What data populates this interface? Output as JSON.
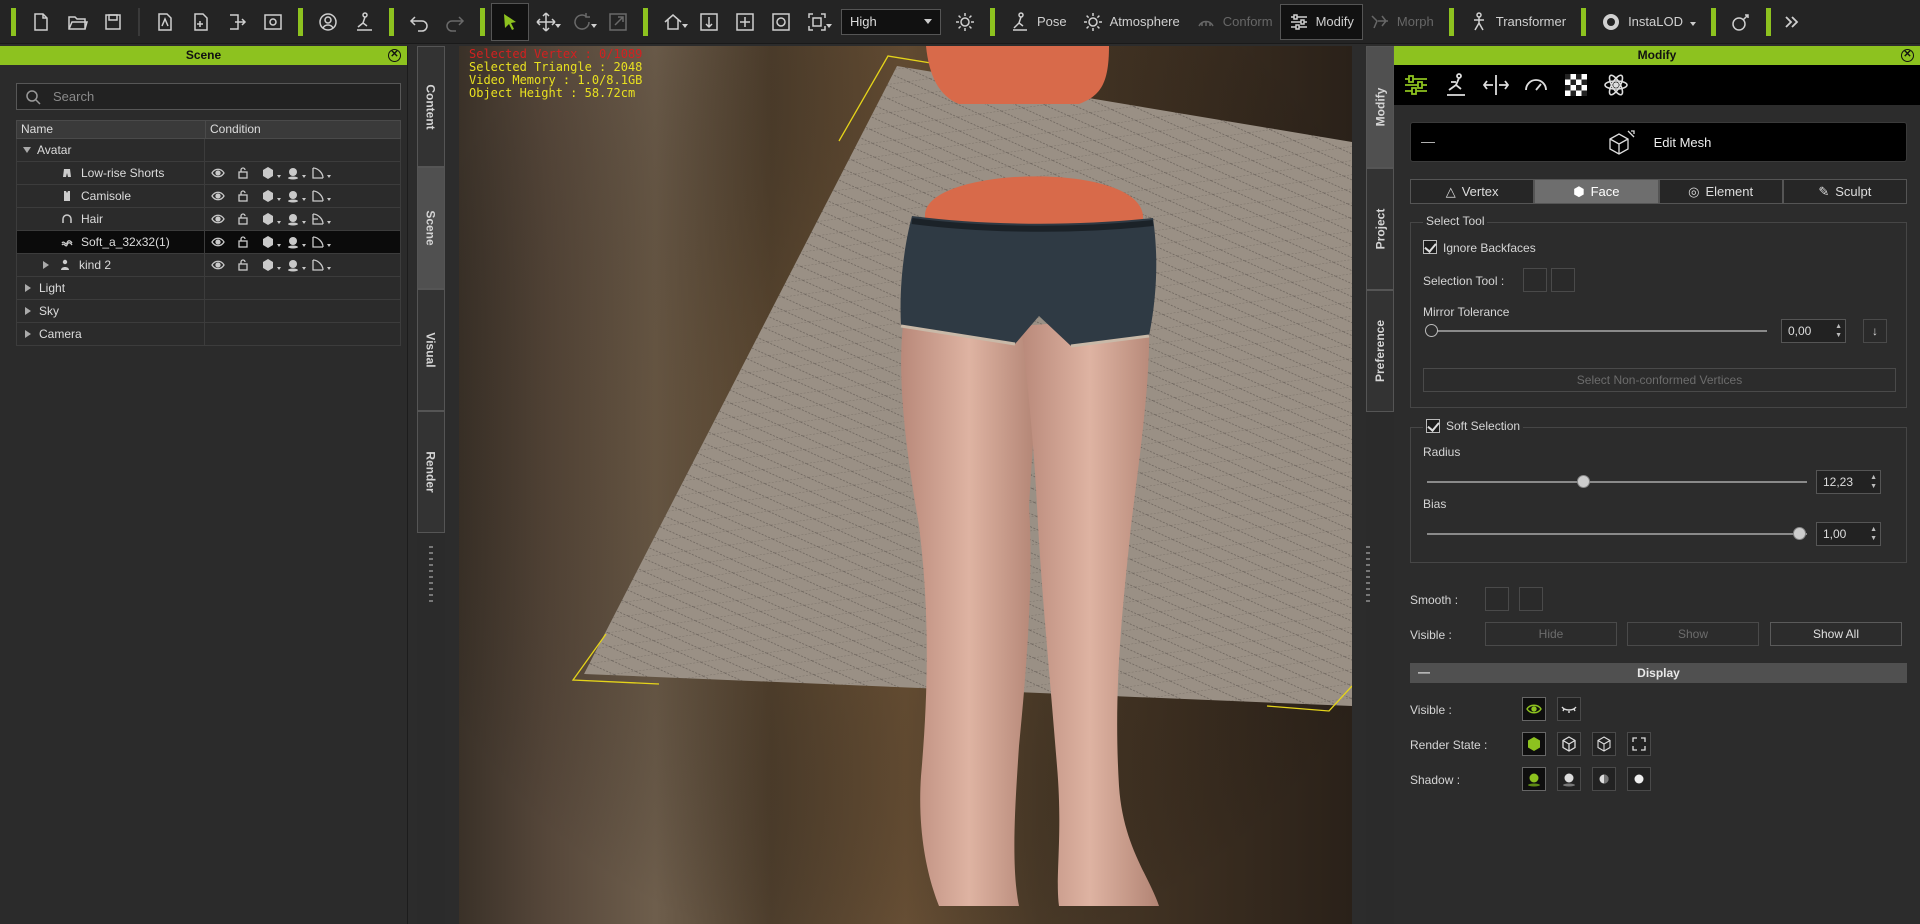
{
  "toolbar": {
    "quality_value": "High",
    "pose_label": "Pose",
    "atmosphere_label": "Atmosphere",
    "conform_label": "Conform",
    "modify_label": "Modify",
    "morph_label": "Morph",
    "transformer_label": "Transformer",
    "instalod_label": "InstaLOD",
    "accent_color": "#8dc21f"
  },
  "scene": {
    "title": "Scene",
    "search_placeholder": "Search",
    "col_name": "Name",
    "col_condition": "Condition",
    "items": [
      {
        "label": "Avatar"
      },
      {
        "label": "Low-rise Shorts"
      },
      {
        "label": "Camisole"
      },
      {
        "label": "Hair"
      },
      {
        "label": "Soft_a_32x32(1)"
      },
      {
        "label": "kind 2"
      },
      {
        "label": "Light"
      },
      {
        "label": "Sky"
      },
      {
        "label": "Camera"
      }
    ]
  },
  "left_tabs": {
    "content": "Content",
    "scene": "Scene",
    "visual": "Visual",
    "render": "Render"
  },
  "right_tabs": {
    "modify": "Modify",
    "project": "Project",
    "preference": "Preference"
  },
  "viewport": {
    "line1": "Selected Vertex : 0/1089",
    "line2": "Selected Triangle : 2048",
    "line3": "Video Memory : 1.0/8.1GB",
    "line4": "Object Height : 58.72cm"
  },
  "modify": {
    "title": "Modify",
    "edit_mesh": "Edit Mesh",
    "modes": [
      "Vertex",
      "Face",
      "Element",
      "Sculpt"
    ],
    "select_tool": "Select Tool",
    "ignore_backfaces": "Ignore Backfaces",
    "selection_tool": "Selection Tool :",
    "mirror_tolerance": "Mirror Tolerance",
    "mirror_value": "0,00",
    "select_nonconformed": "Select Non-conformed Vertices",
    "soft_selection": "Soft Selection",
    "radius_label": "Radius",
    "radius_value": "12,23",
    "bias_label": "Bias",
    "bias_value": "1,00",
    "smooth_label": "Smooth :",
    "visible_label": "Visible :",
    "hide": "Hide",
    "show": "Show",
    "show_all": "Show All",
    "display": "Display",
    "disp_visible": "Visible :",
    "render_state": "Render State :",
    "shadow": "Shadow :"
  }
}
